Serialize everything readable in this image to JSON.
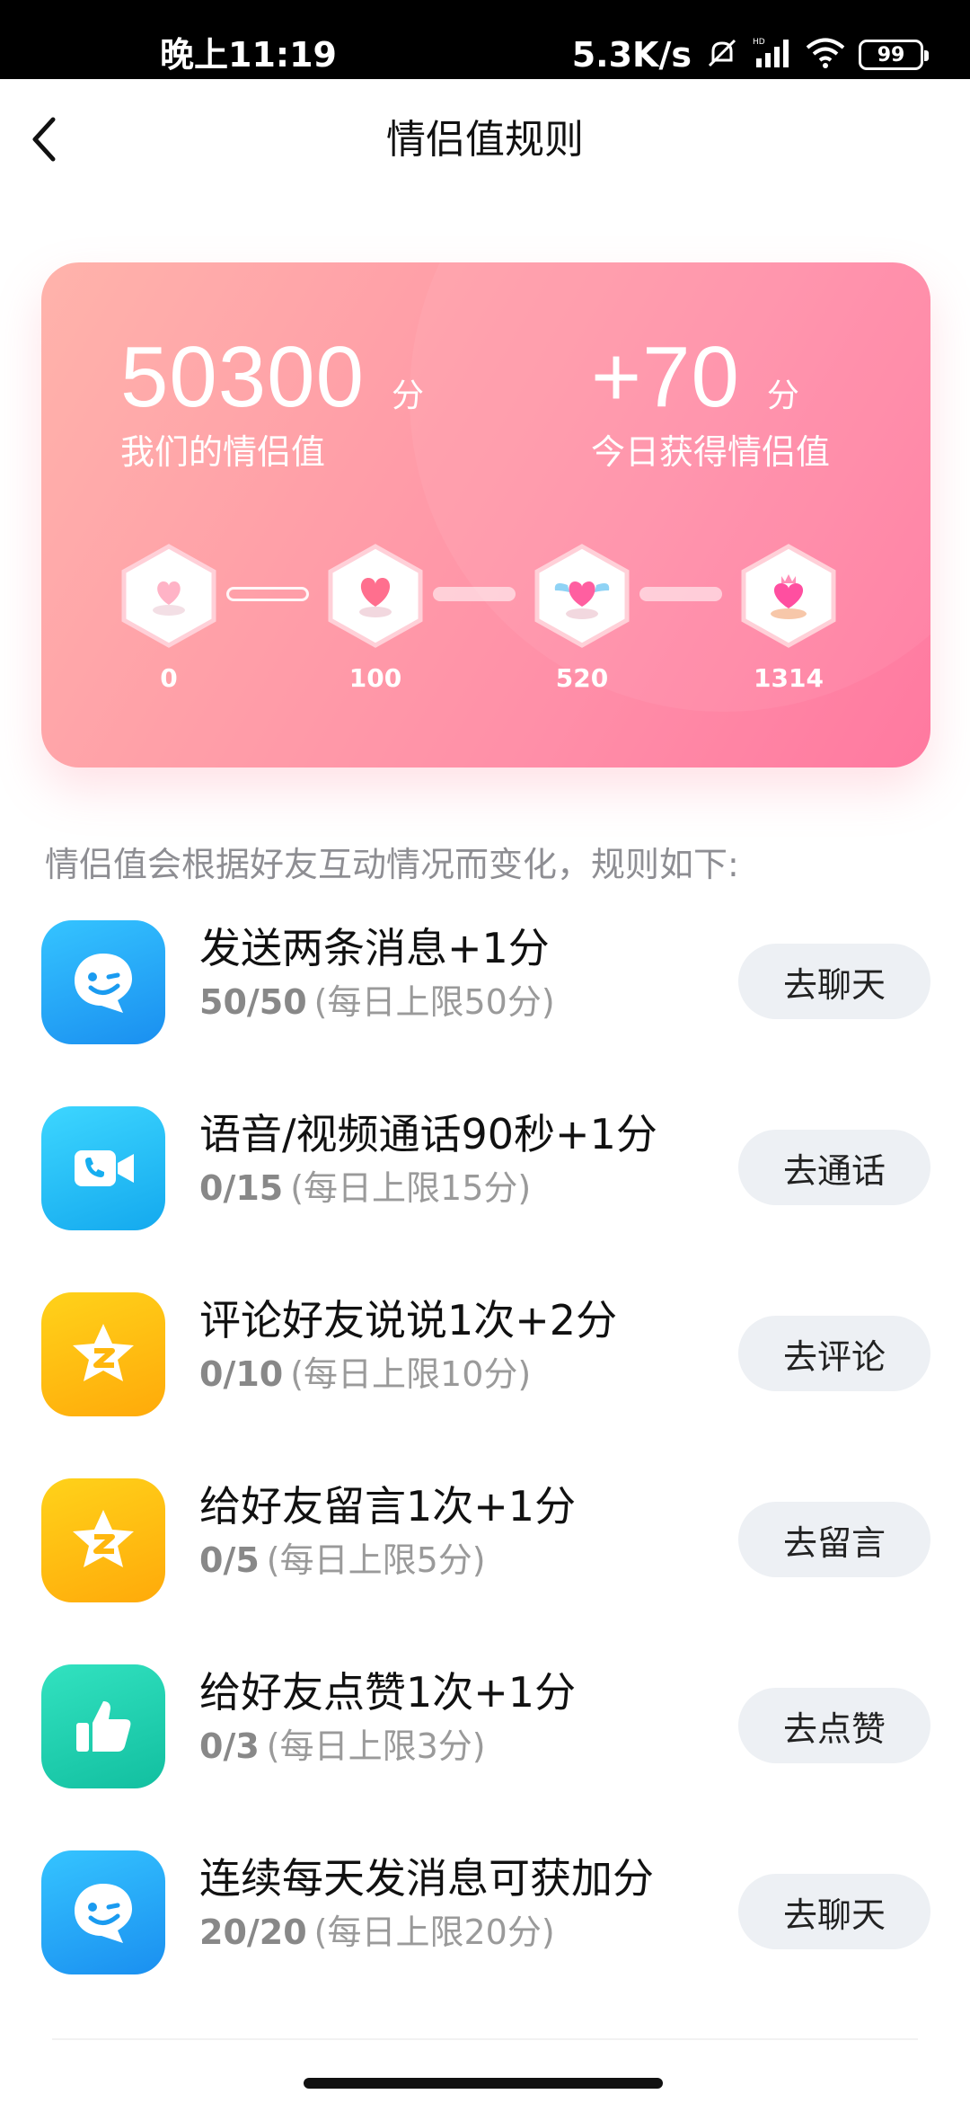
{
  "status_bar": {
    "time": "晚上11:19",
    "net_speed": "5.3K/s",
    "battery": "99",
    "icons": [
      "mute-icon",
      "signal-icon",
      "wifi-icon",
      "battery-icon"
    ]
  },
  "header": {
    "title": "情侣值规则",
    "back_icon": "back-arrow-icon"
  },
  "score_card": {
    "total_value": "50300",
    "total_unit": "分",
    "total_label": "我们的情侣值",
    "today_value": "+70",
    "today_unit": "分",
    "today_label": "今日获得情侣值",
    "levels": [
      {
        "value": "0",
        "icon": "small-heart-icon"
      },
      {
        "value": "100",
        "icon": "heart-icon"
      },
      {
        "value": "520",
        "icon": "winged-heart-icon"
      },
      {
        "value": "1314",
        "icon": "crowned-heart-icon"
      }
    ]
  },
  "rules": {
    "intro": "情侣值会根据好友互动情况而变化，规则如下:",
    "items": [
      {
        "title": "发送两条消息+1分",
        "count": "50/50",
        "limit": "(每日上限50分)",
        "button": "去聊天",
        "icon": "chat-bubble-icon",
        "color": "#1aa7f5"
      },
      {
        "title": "语音/视频通话90秒+1分",
        "count": "0/15",
        "limit": "(每日上限15分)",
        "button": "去通话",
        "icon": "video-call-icon",
        "color": "#1ec0f5"
      },
      {
        "title": "评论好友说说1次+2分",
        "count": "0/10",
        "limit": "(每日上限10分)",
        "button": "去评论",
        "icon": "qzone-star-icon",
        "color": "#ffbf0f"
      },
      {
        "title": "给好友留言1次+1分",
        "count": "0/5",
        "limit": "(每日上限5分)",
        "button": "去留言",
        "icon": "qzone-star-icon",
        "color": "#ffbf0f"
      },
      {
        "title": "给好友点赞1次+1分",
        "count": "0/3",
        "limit": "(每日上限3分)",
        "button": "去点赞",
        "icon": "thumbs-up-icon",
        "color": "#1ccfad"
      },
      {
        "title": "连续每天发消息可获加分",
        "count": "20/20",
        "limit": "(每日上限20分)",
        "button": "去聊天",
        "icon": "chat-bubble-icon",
        "color": "#1aa7f5"
      }
    ]
  }
}
